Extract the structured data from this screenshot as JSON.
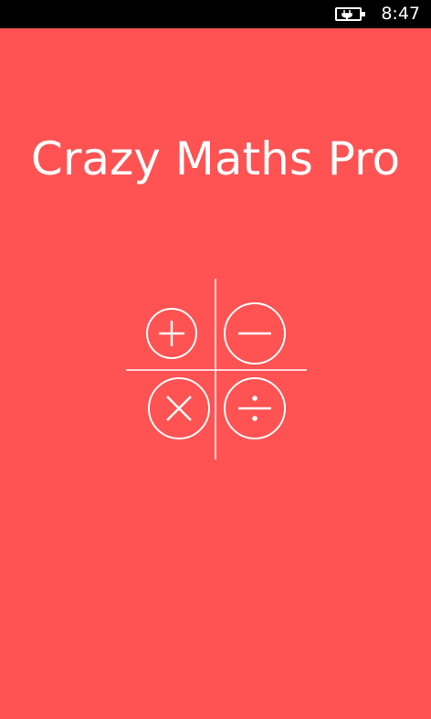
{
  "status_bar": {
    "time": "8:47",
    "battery_icon": "battery-charging-icon"
  },
  "app": {
    "title": "Crazy Maths Pro"
  },
  "logo": {
    "icons": [
      "plus-icon",
      "minus-icon",
      "multiply-icon",
      "divide-icon"
    ]
  },
  "colors": {
    "background": "#ff5252",
    "status_bar": "#000000",
    "foreground": "#ffffff"
  }
}
